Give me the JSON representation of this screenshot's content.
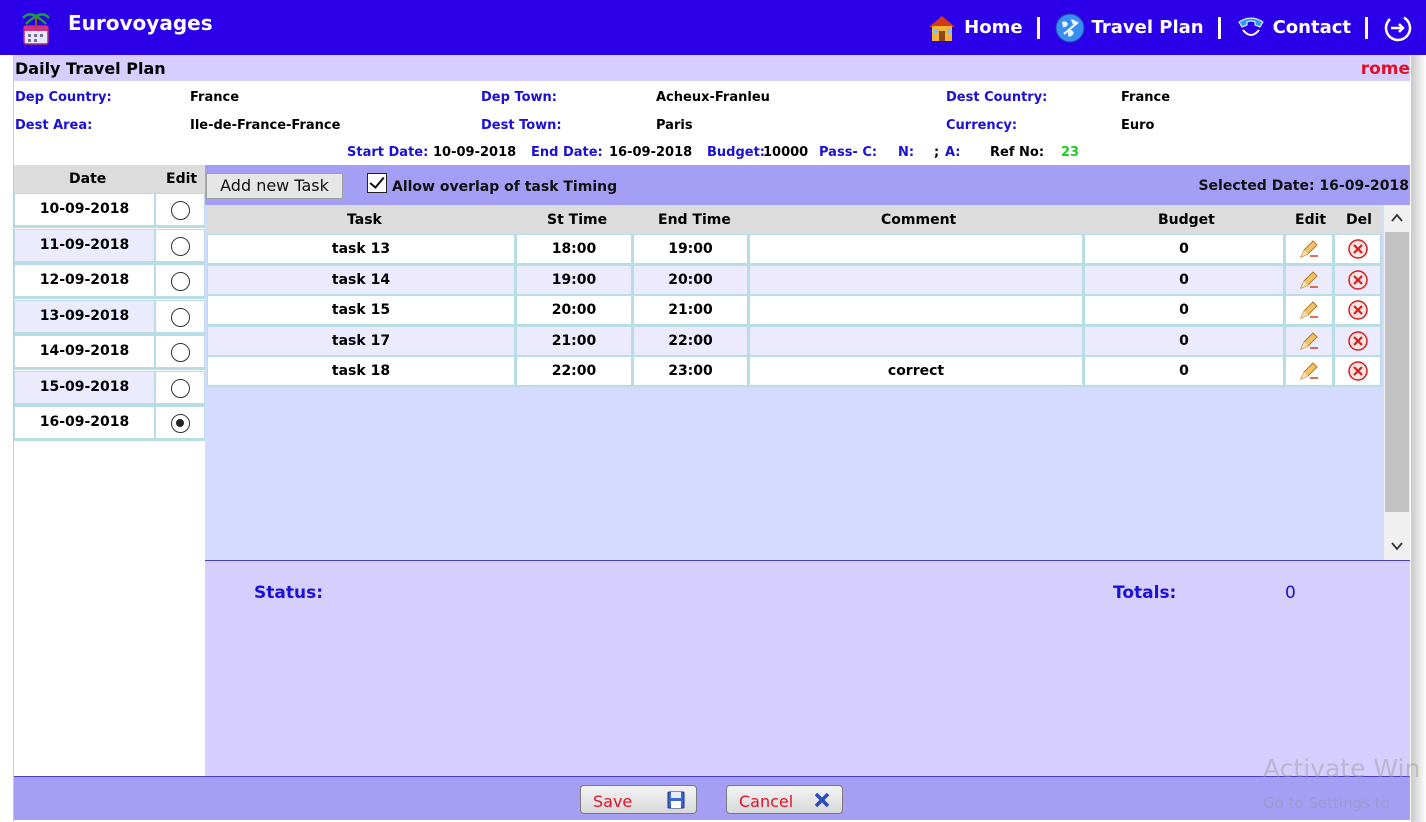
{
  "header": {
    "app_title": "Eurovoyages",
    "nav": [
      {
        "label": "Home",
        "icon": "home-icon"
      },
      {
        "label": "Travel Plan",
        "icon": "globe-icon"
      },
      {
        "label": "Contact",
        "icon": "phone-icon"
      }
    ],
    "logout_icon": "logout-icon"
  },
  "page": {
    "title": "Daily Travel Plan",
    "user": "rome"
  },
  "info": {
    "dep_country_label": "Dep Country:",
    "dep_country": "France",
    "dep_town_label": "Dep Town:",
    "dep_town": "Acheux-Franleu",
    "dest_country_label": "Dest Country:",
    "dest_country": "France",
    "dest_area_label": "Dest Area:",
    "dest_area": "Ile-de-France-France",
    "dest_town_label": "Dest Town:",
    "dest_town": "Paris",
    "currency_label": "Currency:",
    "currency": "Euro",
    "start_date_label": "Start Date:",
    "start_date": "10-09-2018",
    "end_date_label": "End Date:",
    "end_date": "16-09-2018",
    "budget_label": "Budget:",
    "budget": "10000",
    "pass_c_label": "Pass- C:",
    "n_label": "N:",
    "n_value": ";",
    "a_label": "A:",
    "ref_no_label": "Ref No:",
    "ref_no": "23"
  },
  "dates": {
    "header_date": "Date",
    "header_edit": "Edit",
    "rows": [
      {
        "date": "10-09-2018",
        "selected": false
      },
      {
        "date": "11-09-2018",
        "selected": false
      },
      {
        "date": "12-09-2018",
        "selected": false
      },
      {
        "date": "13-09-2018",
        "selected": false
      },
      {
        "date": "14-09-2018",
        "selected": false
      },
      {
        "date": "15-09-2018",
        "selected": false
      },
      {
        "date": "16-09-2018",
        "selected": true
      }
    ]
  },
  "toolbar": {
    "add_task": "Add new Task",
    "allow_overlap": "Allow overlap of task Timing",
    "allow_overlap_checked": true,
    "selected_date": "Selected Date: 16-09-2018"
  },
  "tasks": {
    "columns": [
      "Task",
      "St Time",
      "End Time",
      "Comment",
      "Budget",
      "Edit",
      "Del"
    ],
    "rows": [
      {
        "task": "task 13",
        "st_time": "18:00",
        "end_time": "19:00",
        "comment": "",
        "budget": "0"
      },
      {
        "task": "task 14",
        "st_time": "19:00",
        "end_time": "20:00",
        "comment": "",
        "budget": "0"
      },
      {
        "task": "task 15",
        "st_time": "20:00",
        "end_time": "21:00",
        "comment": "",
        "budget": "0"
      },
      {
        "task": "task 17",
        "st_time": "21:00",
        "end_time": "22:00",
        "comment": "",
        "budget": "0"
      },
      {
        "task": "task 18",
        "st_time": "22:00",
        "end_time": "23:00",
        "comment": "correct",
        "budget": "0"
      }
    ]
  },
  "summary": {
    "status_label": "Status:",
    "totals_label": "Totals:",
    "totals_value": "0"
  },
  "footer": {
    "save": "Save",
    "cancel": "Cancel"
  },
  "watermark": {
    "line1": "Activate Win",
    "line2": "Go to Settings to"
  },
  "colors": {
    "topbar": "#2b00e8",
    "label_blue": "#1a10d6",
    "accent_red": "#e0102a",
    "panel_purple": "#a59ef5",
    "ref_green": "#22cc22"
  }
}
